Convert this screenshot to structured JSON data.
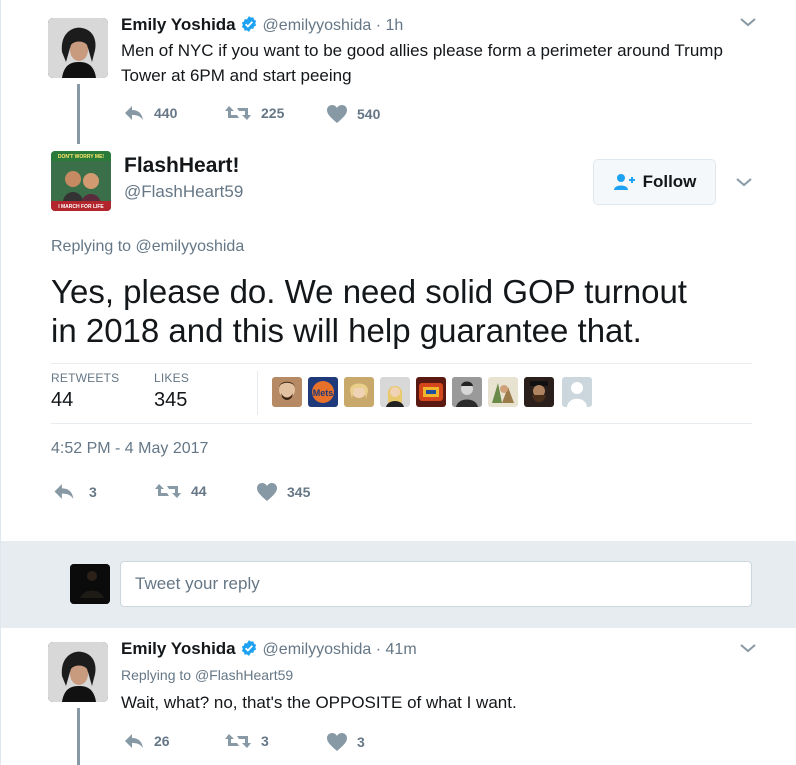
{
  "tweet1": {
    "name": "Emily Yoshida",
    "handle": "@emilyyoshida",
    "sep": "·",
    "time": "1h",
    "text_line1": "Men of NYC if you want to be good allies please form a perimeter around Trump",
    "text_line2": "Tower at 6PM and start peeing",
    "replies": "440",
    "retweets": "225",
    "likes": "540"
  },
  "main_tweet": {
    "name": "FlashHeart!",
    "handle": "@FlashHeart59",
    "follow_label": "Follow",
    "replying_prefix": "Replying to",
    "replying_handle": "@emilyyoshida",
    "text_line1": "Yes, please do. We need solid GOP turnout",
    "text_line2": "in 2018 and this will help guarantee that.",
    "retweets_label": "RETWEETS",
    "retweets_count": "44",
    "likes_label": "LIKES",
    "likes_count": "345",
    "timestamp": "4:52 PM - 4 May 2017",
    "replies": "3",
    "retweets": "44",
    "likes": "345",
    "avatar_banner_top": "DON'T WORRY ME!",
    "avatar_banner_bottom": "I MARCH FOR LIFE"
  },
  "reply_box": {
    "placeholder": "Tweet your reply"
  },
  "tweet3": {
    "name": "Emily Yoshida",
    "handle": "@emilyyoshida",
    "sep": "·",
    "time": "41m",
    "replying_prefix": "Replying to",
    "replying_handle": "@FlashHeart59",
    "text": "Wait, what? no, that's the OPPOSITE of what I want.",
    "replies": "26",
    "retweets": "3",
    "likes": "3"
  },
  "colors": {
    "accent": "#1da1f2",
    "gray_text": "#657786",
    "divider": "#e6ecf0",
    "like_red": "#e0245e"
  },
  "liker_avatars": [
    "liker-1",
    "liker-2",
    "liker-3",
    "liker-4",
    "liker-5",
    "liker-6",
    "liker-7",
    "liker-8",
    "liker-9",
    "default-avatar"
  ]
}
